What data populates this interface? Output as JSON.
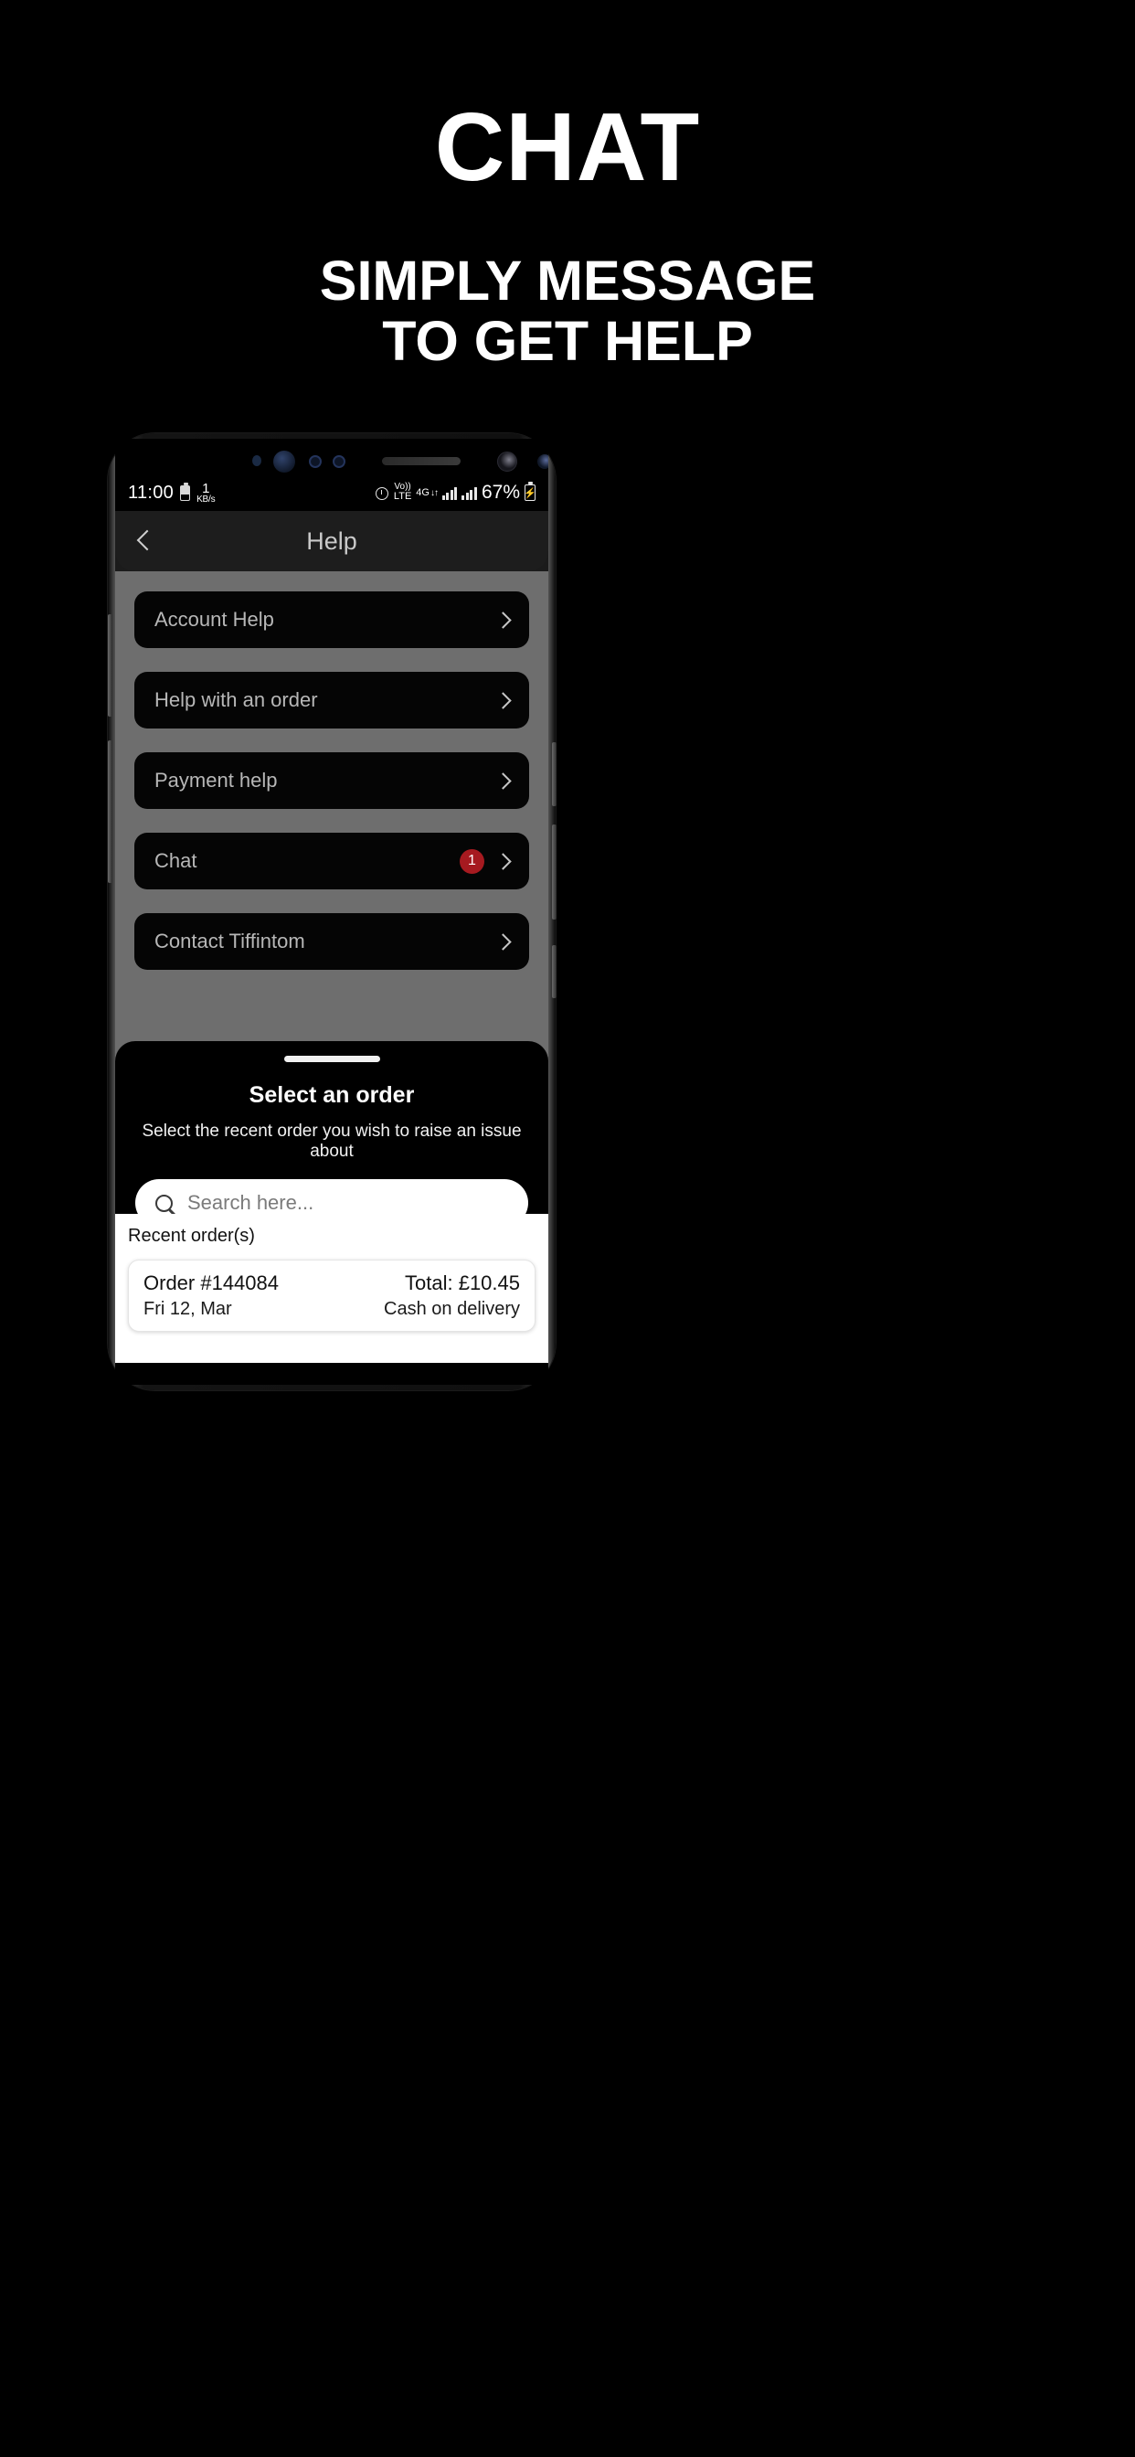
{
  "promo": {
    "title": "CHAT",
    "subtitle_line1": "SIMPLY MESSAGE",
    "subtitle_line2": "TO GET HELP"
  },
  "status_bar": {
    "time": "11:00",
    "data_rate_value": "1",
    "data_rate_unit": "KB/s",
    "volte_top": "Vo))",
    "volte_bottom": "LTE",
    "network": "4G",
    "network_arrows": "↓↑",
    "battery_percent": "67%",
    "icons": {
      "battery_saver": "battery-icon",
      "alarm": "alarm-clock-icon",
      "signal_1": "signal-bars-icon",
      "signal_2": "signal-bars-icon",
      "charging": "battery-charging-icon"
    }
  },
  "app_header": {
    "back_icon": "back-chevron-icon",
    "title": "Help"
  },
  "help_list": {
    "items": [
      {
        "label": "Account Help",
        "badge": "",
        "chevron": "chevron-right-icon"
      },
      {
        "label": "Help with an order",
        "badge": "",
        "chevron": "chevron-right-icon"
      },
      {
        "label": "Payment help",
        "badge": "",
        "chevron": "chevron-right-icon"
      },
      {
        "label": "Chat",
        "badge": "1",
        "chevron": "chevron-right-icon"
      },
      {
        "label": "Contact Tiffintom",
        "badge": "",
        "chevron": "chevron-right-icon"
      }
    ]
  },
  "bottom_sheet": {
    "handle": "drag-handle",
    "title": "Select an order",
    "subtitle": "Select the recent order you wish to raise an issue about",
    "search": {
      "icon": "search-icon",
      "placeholder": "Search here...",
      "value": ""
    },
    "recent_label": "Recent order(s)",
    "orders": [
      {
        "order_id": "Order #144084",
        "date": "Fri 12, Mar",
        "total": "Total: £10.45",
        "payment": "Cash on delivery"
      }
    ]
  },
  "colors": {
    "page_background": "#000000",
    "promo_text": "#ffffff",
    "screen_background": "#6e6e6e",
    "row_background": "#050505",
    "row_text": "#b7b7b7",
    "badge_background": "#a61a20",
    "sheet_background": "#000000",
    "white_area": "#ffffff"
  }
}
